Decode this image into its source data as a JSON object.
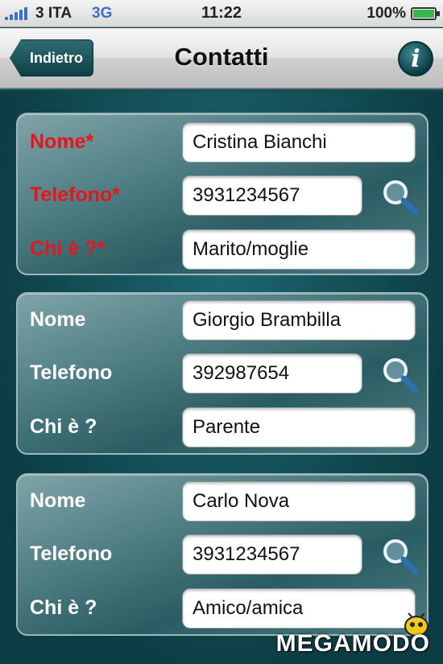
{
  "status_bar": {
    "carrier": "3 ITA",
    "network": "3G",
    "time": "11:22",
    "battery": "100%"
  },
  "nav": {
    "back_label": "Indietro",
    "title": "Contatti",
    "info_label": "i"
  },
  "contacts": [
    {
      "name_label": "Nome*",
      "phone_label": "Telefono*",
      "relation_label": "Chi è ?*",
      "name": "Cristina Bianchi",
      "phone": "3931234567",
      "relation": "Marito/moglie",
      "required": true
    },
    {
      "name_label": "Nome",
      "phone_label": "Telefono",
      "relation_label": "Chi è ?",
      "name": "Giorgio Brambilla",
      "phone": "392987654",
      "relation": "Parente",
      "required": false
    },
    {
      "name_label": "Nome",
      "phone_label": "Telefono",
      "relation_label": "Chi è ?",
      "name": "Carlo Nova",
      "phone": "3931234567",
      "relation": "Amico/amica",
      "required": false
    }
  ],
  "watermark": "MEGAMODO",
  "colors": {
    "required_label": "#e8141c",
    "background": "#0f4a52",
    "card": "#4f7e84"
  },
  "icons": {
    "search": "search-icon",
    "info": "info-icon",
    "back": "back-arrow"
  }
}
